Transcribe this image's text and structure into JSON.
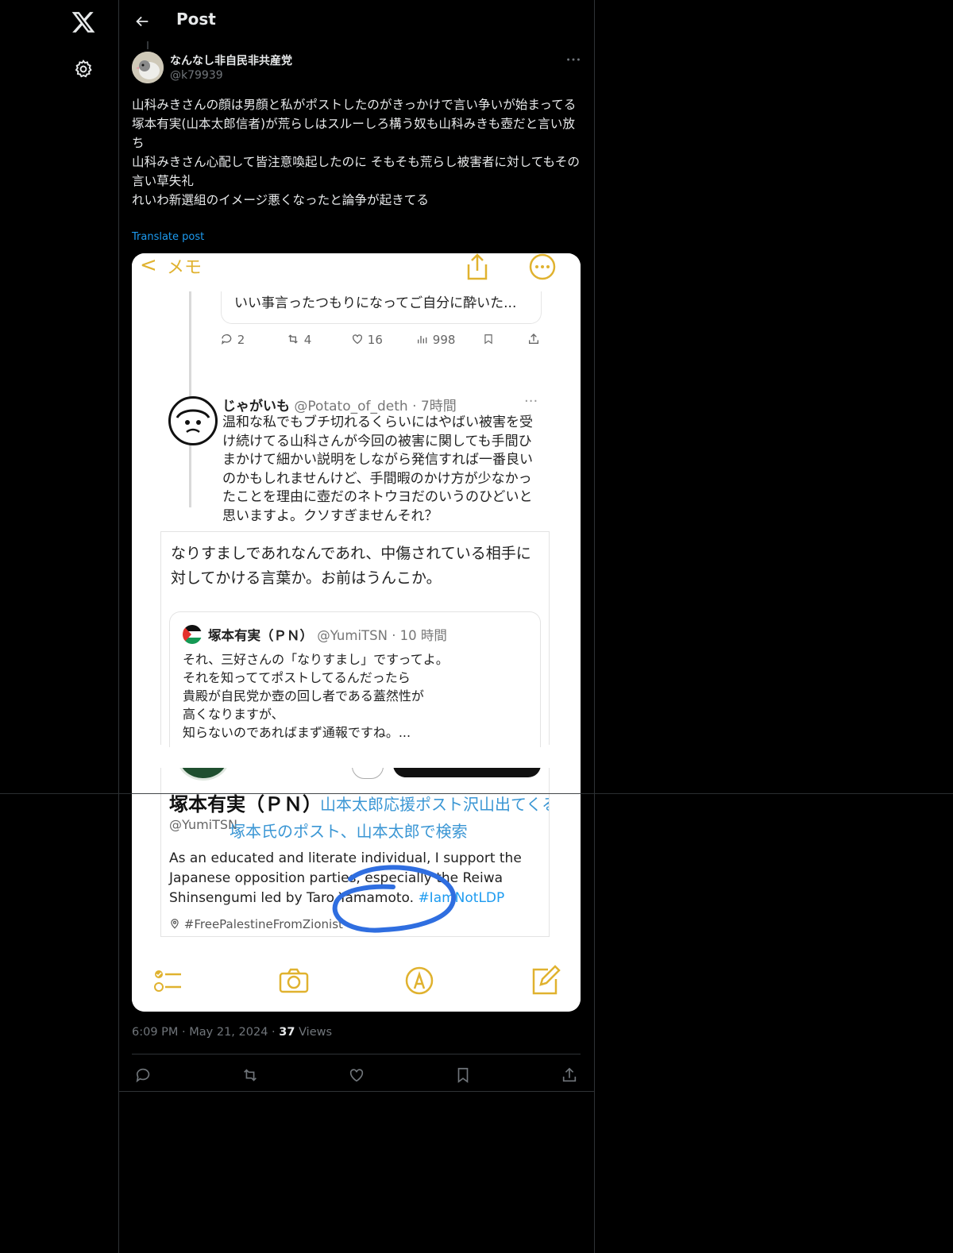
{
  "header": {
    "title": "Post"
  },
  "author": {
    "name": "なんなし非自民非共産党",
    "handle": "@k79939"
  },
  "post": {
    "lines": [
      "山科みきさんの顔は男顔と私がポストしたのがきっかけで言い争いが始まってる",
      "塚本有実(山本太郎信者)が荒らしはスルーしろ構う奴も山科みきも壺だと言い放ち",
      "山科みきさん心配して皆注意喚起したのに そもそも荒らし被害者に対してもその言い草失礼",
      "れいわ新選組のイメージ悪くなったと論争が起きてる"
    ],
    "translate": "Translate post"
  },
  "media": {
    "memo_title": "メモ",
    "back_glyph": "<",
    "reply_text": "いい事言ったつもりになってご自分に酔いた...",
    "actions": {
      "reply": "2",
      "repost": "4",
      "like": "16",
      "views": "998"
    },
    "tweet2": {
      "name": "じゃがいも",
      "meta": "@Potato_of_deth · 7時間",
      "dots": "···",
      "body": "温和な私でもブチ切れるくらいにはやばい被害を受け続けてる山科さんが今回の被害に関しても手間ひまかけて細かい説明をしながら発信すれば一番良いのかもしれませんけど、手間暇のかけ方が少なかったことを理由に壺だのネトウヨだのいうのひどいと思いますよ。クソすぎませんそれ？"
    },
    "tweet3": {
      "text": "なりすましであれなんであれ、中傷されている相手に対してかける言葉か。お前はうんこか。",
      "quote_name": "塚本有実（ＰＮ）",
      "quote_meta": "@YumiTSN · 10 時間",
      "quote_lines": [
        "それ、三好さんの「なりすまし」ですってよ。",
        "それを知っててポストしてるんだったら",
        "貴殿が自民党か壺の回し者である蓋然性が",
        "高くなりますが、",
        "知らないのであればまず通報ですね。..."
      ]
    },
    "profile": {
      "name": "塚本有実（ＰＮ）",
      "handle": "@YumiTSN",
      "annotation1": "山本太郎応援ポスト沢山出てくる",
      "annotation2": "塚本氏のポスト、山本太郎で検索",
      "bio": "As an educated and literate individual, I support the Japanese opposition parties, especially the Reiwa Shinsengumi led by Taro Yamamoto.",
      "bio_tag": "#IamNotLDP",
      "location": "#FreePalestineFromZionist"
    },
    "colors": {
      "memo_accent": "#e0b22f",
      "annotation": "#3a96d4",
      "circle": "#2f6ee0"
    }
  },
  "footer": {
    "time": "6:09 PM",
    "date": "May 21, 2024",
    "dot": "·",
    "views_count": "37",
    "views_label": "Views"
  },
  "colors": {
    "background": "#000000",
    "text": "#e7e9ea",
    "muted": "#71767b",
    "link": "#1d9bf0",
    "border": "#2f3336"
  }
}
